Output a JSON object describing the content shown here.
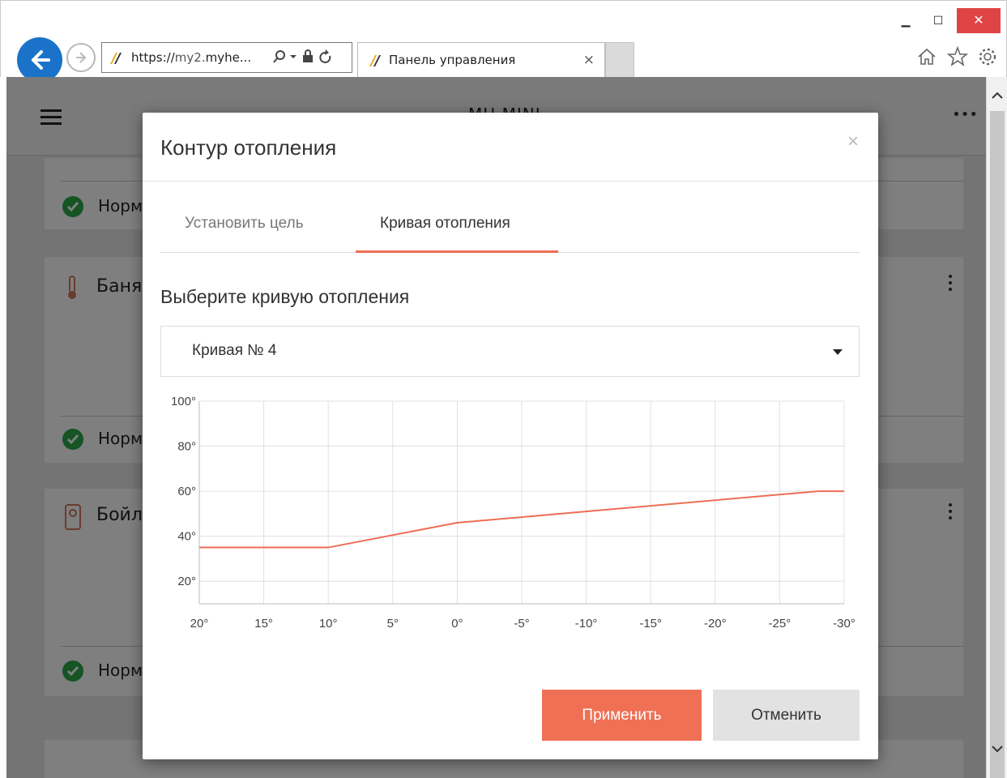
{
  "browser": {
    "url_scheme": "https://",
    "url_domain_dim": "my2.",
    "url_domain_bold": "myhe...",
    "tab_title": "Панель управления",
    "tab_close": "×",
    "win_min": "▁",
    "win_max": "☐",
    "win_close": "✕"
  },
  "app": {
    "title": "MH MINI",
    "more": "•••",
    "cards": [
      {
        "status": "Норм"
      },
      {
        "title": "Баня",
        "status": "Норм"
      },
      {
        "title": "Бойл",
        "status": "Норм"
      }
    ]
  },
  "modal": {
    "title": "Контур отопления",
    "close": "×",
    "tabs": [
      {
        "label": "Установить цель",
        "active": false
      },
      {
        "label": "Кривая отопления",
        "active": true
      }
    ],
    "section_label": "Выберите кривую отопления",
    "select_value": "Кривая № 4",
    "apply_label": "Применить",
    "cancel_label": "Отменить"
  },
  "colors": {
    "accent": "#ee6e55",
    "status_ok": "#2aa84a",
    "browser_back": "#1a73c9",
    "close_red": "#e04343"
  },
  "chart_data": {
    "type": "line",
    "title": "",
    "xlabel": "",
    "ylabel": "",
    "x_ticks": [
      "20°",
      "15°",
      "10°",
      "5°",
      "0°",
      "-5°",
      "-10°",
      "-15°",
      "-20°",
      "-25°",
      "-30°"
    ],
    "y_ticks": [
      "100°",
      "80°",
      "60°",
      "40°",
      "20°"
    ],
    "xlim": [
      20,
      -30
    ],
    "ylim": [
      10,
      100
    ],
    "grid": true,
    "series": [
      {
        "color": "#ee6e55",
        "x": [
          20,
          10,
          0,
          -28,
          -30
        ],
        "y": [
          35,
          35,
          46,
          60,
          60
        ]
      }
    ]
  }
}
